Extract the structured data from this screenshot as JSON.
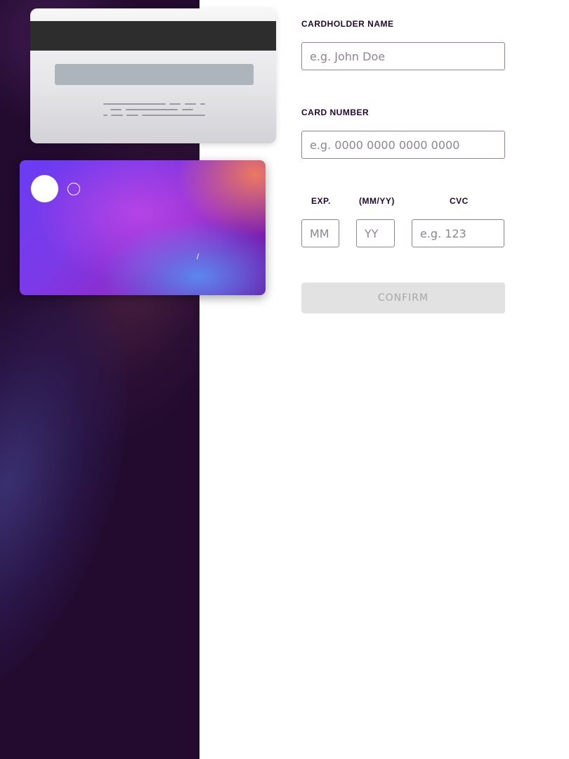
{
  "card_preview": {
    "front": {
      "number": "",
      "name": "",
      "exp_month": "",
      "exp_separator": "/",
      "exp_year": ""
    },
    "back": {
      "cvc": ""
    }
  },
  "form": {
    "cardholder_name": {
      "label": "CARDHOLDER NAME",
      "placeholder": "e.g. John Doe",
      "value": ""
    },
    "card_number": {
      "label": "CARD NUMBER",
      "placeholder": "e.g. 0000 0000 0000 0000",
      "value": ""
    },
    "exp": {
      "label": "EXP.",
      "format_label": "(MM/YY)",
      "month_placeholder": "MM",
      "year_placeholder": "YY"
    },
    "cvc": {
      "label": "CVC",
      "placeholder": "e.g. 123"
    },
    "confirm_label": "CONFIRM"
  },
  "colors": {
    "side_panel": "#220b2f",
    "text_dark": "#21092f",
    "input_border": "#8e8593",
    "button_disabled_bg": "#e2e2e2",
    "button_disabled_text": "#a7a7a7"
  }
}
